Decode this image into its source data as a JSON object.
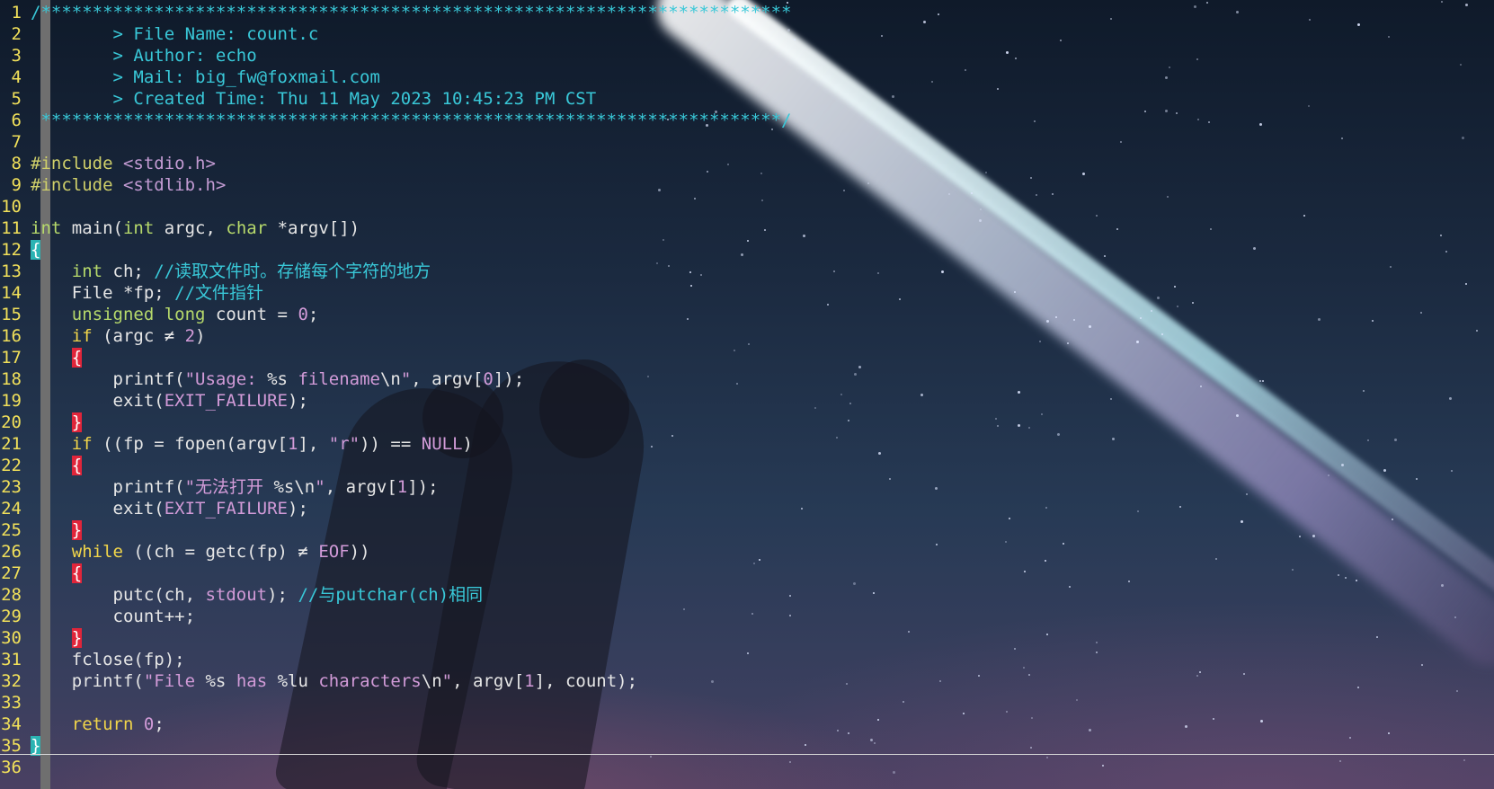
{
  "editor": {
    "colors": {
      "line_number": "#f1e05a",
      "comment": "#39c8d8",
      "keyword": "#f1d54a",
      "type": "#b6d96b",
      "string": "#d29bd8",
      "match_brace_red": "#e0253a",
      "match_brace_cyan": "#2bb3b3"
    },
    "lines": [
      {
        "n": "1",
        "segs": [
          [
            "/*************************************************************************",
            "com"
          ]
        ]
      },
      {
        "n": "2",
        "segs": [
          [
            "        > File Name: count.c",
            "com"
          ]
        ]
      },
      {
        "n": "3",
        "segs": [
          [
            "        > Author: echo",
            "com"
          ]
        ]
      },
      {
        "n": "4",
        "segs": [
          [
            "        > Mail: big_fw@foxmail.com",
            "com"
          ]
        ]
      },
      {
        "n": "5",
        "segs": [
          [
            "        > Created Time: Thu 11 May 2023 10:45:23 PM CST",
            "com"
          ]
        ]
      },
      {
        "n": "6",
        "segs": [
          [
            " ************************************************************************/",
            "com"
          ]
        ]
      },
      {
        "n": "7",
        "segs": []
      },
      {
        "n": "8",
        "segs": [
          [
            "#include ",
            "pp"
          ],
          [
            "<stdio.h>",
            "inc"
          ]
        ]
      },
      {
        "n": "9",
        "segs": [
          [
            "#include ",
            "pp"
          ],
          [
            "<stdlib.h>",
            "inc"
          ]
        ]
      },
      {
        "n": "10",
        "segs": []
      },
      {
        "n": "11",
        "segs": [
          [
            "int",
            "type"
          ],
          [
            " main(",
            ""
          ],
          [
            "int",
            "type"
          ],
          [
            " argc, ",
            ""
          ],
          [
            "char",
            "type"
          ],
          [
            " *argv[])",
            ""
          ]
        ]
      },
      {
        "n": "12",
        "segs": [
          [
            "{",
            "bc"
          ]
        ]
      },
      {
        "n": "13",
        "segs": [
          [
            "    ",
            ""
          ],
          [
            "int",
            "type"
          ],
          [
            " ch; ",
            ""
          ],
          [
            "//读取文件时。存储每个字符的地方",
            "com"
          ]
        ]
      },
      {
        "n": "14",
        "segs": [
          [
            "    File *fp; ",
            ""
          ],
          [
            "//文件指针",
            "com"
          ]
        ]
      },
      {
        "n": "15",
        "segs": [
          [
            "    ",
            ""
          ],
          [
            "unsigned long",
            "type"
          ],
          [
            " count = ",
            ""
          ],
          [
            "0",
            "num"
          ],
          [
            ";",
            ""
          ]
        ]
      },
      {
        "n": "16",
        "segs": [
          [
            "    ",
            ""
          ],
          [
            "if",
            "kw"
          ],
          [
            " (argc ≠ ",
            ""
          ],
          [
            "2",
            "num"
          ],
          [
            ")",
            ""
          ]
        ]
      },
      {
        "n": "17",
        "segs": [
          [
            "    ",
            ""
          ],
          [
            "{",
            "br"
          ]
        ]
      },
      {
        "n": "18",
        "segs": [
          [
            "        printf(",
            ""
          ],
          [
            "\"Usage: ",
            "str"
          ],
          [
            "%s",
            ""
          ],
          [
            " filename",
            "str"
          ],
          [
            "\\n",
            ""
          ],
          [
            "\"",
            "str"
          ],
          [
            ", argv[",
            ""
          ],
          [
            "0",
            "num"
          ],
          [
            "]);",
            ""
          ]
        ]
      },
      {
        "n": "19",
        "segs": [
          [
            "        exit(",
            ""
          ],
          [
            "EXIT_FAILURE",
            "const"
          ],
          [
            ");",
            ""
          ]
        ]
      },
      {
        "n": "20",
        "segs": [
          [
            "    ",
            ""
          ],
          [
            "}",
            "br"
          ]
        ]
      },
      {
        "n": "21",
        "segs": [
          [
            "    ",
            ""
          ],
          [
            "if",
            "kw"
          ],
          [
            " ((fp = fopen(argv[",
            ""
          ],
          [
            "1",
            "num"
          ],
          [
            "], ",
            ""
          ],
          [
            "\"r\"",
            "str"
          ],
          [
            ")) == ",
            ""
          ],
          [
            "NULL",
            "const"
          ],
          [
            ")",
            ""
          ]
        ]
      },
      {
        "n": "22",
        "segs": [
          [
            "    ",
            ""
          ],
          [
            "{",
            "br"
          ]
        ]
      },
      {
        "n": "23",
        "segs": [
          [
            "        printf(",
            ""
          ],
          [
            "\"无法打开 ",
            "str"
          ],
          [
            "%s\\n",
            ""
          ],
          [
            "\"",
            "str"
          ],
          [
            ", argv[",
            ""
          ],
          [
            "1",
            "num"
          ],
          [
            "]);",
            ""
          ]
        ]
      },
      {
        "n": "24",
        "segs": [
          [
            "        exit(",
            ""
          ],
          [
            "EXIT_FAILURE",
            "const"
          ],
          [
            ");",
            ""
          ]
        ]
      },
      {
        "n": "25",
        "segs": [
          [
            "    ",
            ""
          ],
          [
            "}",
            "br"
          ]
        ]
      },
      {
        "n": "26",
        "segs": [
          [
            "    ",
            ""
          ],
          [
            "while",
            "kw"
          ],
          [
            " ((ch = getc(fp) ≠ ",
            ""
          ],
          [
            "EOF",
            "const"
          ],
          [
            "))",
            ""
          ]
        ]
      },
      {
        "n": "27",
        "segs": [
          [
            "    ",
            ""
          ],
          [
            "{",
            "br"
          ]
        ]
      },
      {
        "n": "28",
        "segs": [
          [
            "        putc(ch, ",
            ""
          ],
          [
            "stdout",
            "const"
          ],
          [
            "); ",
            ""
          ],
          [
            "//与putchar(ch)相同",
            "com"
          ]
        ]
      },
      {
        "n": "29",
        "segs": [
          [
            "        count++;",
            ""
          ]
        ]
      },
      {
        "n": "30",
        "segs": [
          [
            "    ",
            ""
          ],
          [
            "}",
            "br"
          ]
        ]
      },
      {
        "n": "31",
        "segs": [
          [
            "    fclose(fp);",
            ""
          ]
        ]
      },
      {
        "n": "32",
        "segs": [
          [
            "    printf(",
            ""
          ],
          [
            "\"File ",
            "str"
          ],
          [
            "%s",
            ""
          ],
          [
            " has ",
            "str"
          ],
          [
            "%lu",
            ""
          ],
          [
            " characters",
            "str"
          ],
          [
            "\\n",
            ""
          ],
          [
            "\"",
            "str"
          ],
          [
            ", argv[",
            ""
          ],
          [
            "1",
            "num"
          ],
          [
            "], count);",
            ""
          ]
        ]
      },
      {
        "n": "33",
        "segs": []
      },
      {
        "n": "34",
        "segs": [
          [
            "    ",
            ""
          ],
          [
            "return",
            "kw"
          ],
          [
            " ",
            ""
          ],
          [
            "0",
            "num"
          ],
          [
            ";",
            ""
          ]
        ]
      },
      {
        "n": "35",
        "segs": [
          [
            "}",
            "bc"
          ]
        ]
      },
      {
        "n": "36",
        "segs": []
      }
    ]
  }
}
